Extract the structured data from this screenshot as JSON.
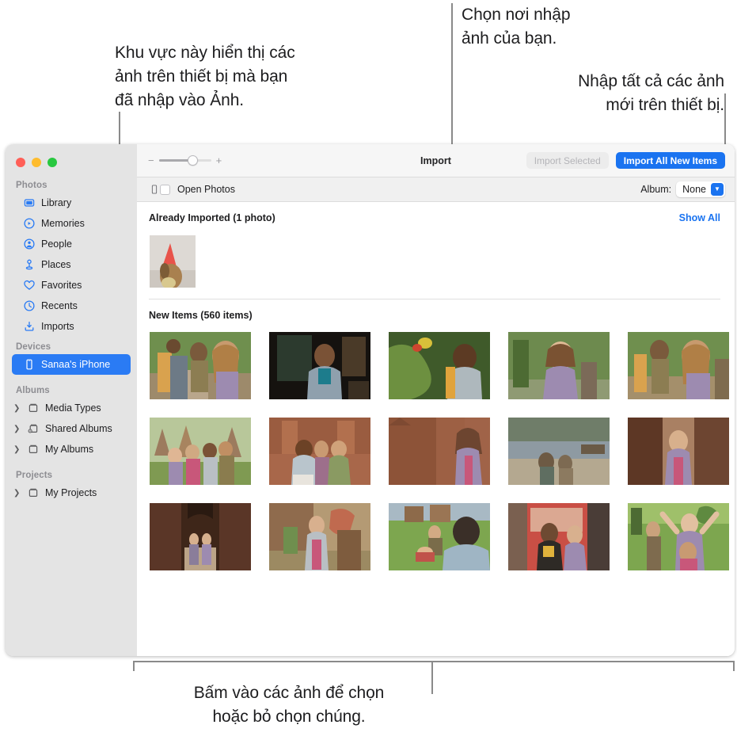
{
  "annotations": {
    "left": "Khu vực này hiển thị các\nảnh trên thiết bị mà bạn\nđã nhập vào Ảnh.",
    "top_right": "Chọn nơi nhập\nảnh của bạn.",
    "mid_right": "Nhập tất cả các ảnh\nmới trên thiết bị.",
    "bottom": "Bấm vào các ảnh để chọn\nhoặc bỏ chọn chúng."
  },
  "window": {
    "traffic_lights": [
      "close",
      "minimize",
      "zoom"
    ]
  },
  "sidebar": {
    "sections": [
      {
        "title": "Photos",
        "items": [
          {
            "label": "Library",
            "icon": "library-icon",
            "selected": false,
            "disclosure": false
          },
          {
            "label": "Memories",
            "icon": "memories-icon",
            "selected": false,
            "disclosure": false
          },
          {
            "label": "People",
            "icon": "people-icon",
            "selected": false,
            "disclosure": false
          },
          {
            "label": "Places",
            "icon": "places-icon",
            "selected": false,
            "disclosure": false
          },
          {
            "label": "Favorites",
            "icon": "heart-icon",
            "selected": false,
            "disclosure": false
          },
          {
            "label": "Recents",
            "icon": "clock-icon",
            "selected": false,
            "disclosure": false
          },
          {
            "label": "Imports",
            "icon": "import-icon",
            "selected": false,
            "disclosure": false
          }
        ]
      },
      {
        "title": "Devices",
        "items": [
          {
            "label": "Sanaa's iPhone",
            "icon": "iphone-icon",
            "selected": true,
            "disclosure": false
          }
        ]
      },
      {
        "title": "Albums",
        "items": [
          {
            "label": "Media Types",
            "icon": "album-icon",
            "selected": false,
            "disclosure": true
          },
          {
            "label": "Shared Albums",
            "icon": "shared-album-icon",
            "selected": false,
            "disclosure": true
          },
          {
            "label": "My Albums",
            "icon": "album-icon",
            "selected": false,
            "disclosure": true
          }
        ]
      },
      {
        "title": "Projects",
        "items": [
          {
            "label": "My Projects",
            "icon": "album-icon",
            "selected": false,
            "disclosure": true
          }
        ]
      }
    ]
  },
  "toolbar": {
    "title": "Import",
    "zoom_minus": "−",
    "zoom_plus": "+",
    "import_selected_label": "Import Selected",
    "import_all_label": "Import All New Items",
    "accent_color": "#1a73f0"
  },
  "subbar": {
    "device_icon": "iphone-icon",
    "open_photos_label": "Open Photos",
    "open_photos_checked": false,
    "album_label": "Album:",
    "album_value": "None"
  },
  "content": {
    "already_imported": {
      "title": "Already Imported (1 photo)",
      "show_all_label": "Show All",
      "thumbnails": [
        {
          "name": "dog-party-hat",
          "colors": [
            "#d8d4cf",
            "#e8534a",
            "#b58a56",
            "#8d6a3f"
          ]
        }
      ]
    },
    "new_items": {
      "title": "New Items (560 items)",
      "thumbnails": [
        {
          "name": "two-hikers-path",
          "colors": [
            "#6f8f4e",
            "#9d7a5d",
            "#b9a68c",
            "#8c6f52"
          ]
        },
        {
          "name": "man-at-cafe",
          "colors": [
            "#1d1a16",
            "#3b3730",
            "#7c8f9c",
            "#2a2722"
          ]
        },
        {
          "name": "man-with-flowers",
          "colors": [
            "#4d6b33",
            "#8fae54",
            "#d8c03a",
            "#3f5a2a"
          ]
        },
        {
          "name": "woman-smiling-green",
          "colors": [
            "#5f7d43",
            "#9aa77c",
            "#7b6a58",
            "#46603a"
          ]
        },
        {
          "name": "couple-laughing",
          "colors": [
            "#6f8f4e",
            "#a88f6f",
            "#9d8bb0",
            "#7e6b4e"
          ]
        },
        {
          "name": "group-at-ruins",
          "colors": [
            "#9c7b5e",
            "#b8a27f",
            "#6f8f4e",
            "#7d6350"
          ]
        },
        {
          "name": "three-friends-brick",
          "colors": [
            "#a8674a",
            "#c08466",
            "#8c5a3e",
            "#b9875f"
          ]
        },
        {
          "name": "woman-brick-temple",
          "colors": [
            "#a06348",
            "#bc8360",
            "#7e5038",
            "#caa177"
          ]
        },
        {
          "name": "two-by-river",
          "colors": [
            "#8e9aa2",
            "#6f7d69",
            "#b4a890",
            "#5f6e61"
          ]
        },
        {
          "name": "woman-in-archway",
          "colors": [
            "#8c5b40",
            "#6d4531",
            "#a98063",
            "#4f3324"
          ]
        },
        {
          "name": "walkers-in-corridor",
          "colors": [
            "#7a4e38",
            "#5a3627",
            "#a07a5e",
            "#3e2619"
          ]
        },
        {
          "name": "woman-by-tree",
          "colors": [
            "#8f6b4d",
            "#a98a62",
            "#6f8f4e",
            "#c06a4f"
          ]
        },
        {
          "name": "picnic-on-grass",
          "colors": [
            "#5f8a40",
            "#7da64f",
            "#3a3430",
            "#9fb070"
          ]
        },
        {
          "name": "two-women-market",
          "colors": [
            "#c94f45",
            "#dba892",
            "#7b5f50",
            "#4a3d37"
          ]
        },
        {
          "name": "friends-arms-raised",
          "colors": [
            "#5f8a40",
            "#8fae54",
            "#9d8bb0",
            "#456b33"
          ]
        }
      ]
    }
  }
}
